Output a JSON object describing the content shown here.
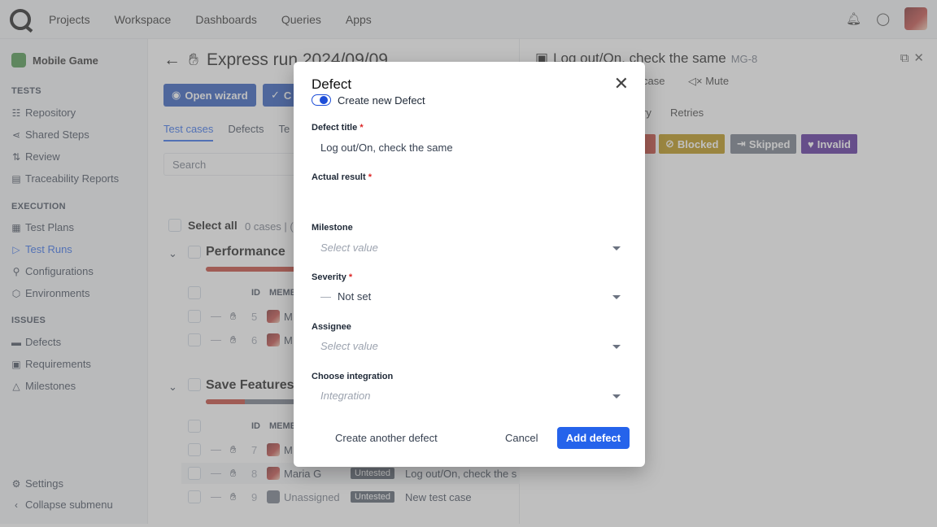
{
  "topnav": {
    "items": [
      "Projects",
      "Workspace",
      "Dashboards",
      "Queries",
      "Apps"
    ]
  },
  "sidebar": {
    "project": "Mobile Game",
    "sections": {
      "tests": "TESTS",
      "execution": "EXECUTION",
      "issues": "ISSUES"
    },
    "tests_items": [
      "Repository",
      "Shared Steps",
      "Review",
      "Traceability Reports"
    ],
    "execution_items": [
      "Test Plans",
      "Test Runs",
      "Configurations",
      "Environments"
    ],
    "issues_items": [
      "Defects",
      "Requirements",
      "Milestones"
    ],
    "settings": "Settings",
    "collapse": "Collapse submenu"
  },
  "middle": {
    "title": "Express run 2024/09/09",
    "open_wizard": "Open wizard",
    "second_btn": "C",
    "tabs": [
      "Test cases",
      "Defects",
      "Te"
    ],
    "search_placeholder": "Search",
    "select_all": "Select all",
    "cases_count": "0 cases | (",
    "suite1": "Performance",
    "suite2": "Save Features",
    "col_id": "ID",
    "col_member": "MEMB",
    "rows": [
      {
        "id": "5",
        "member": "M"
      },
      {
        "id": "6",
        "member": "M"
      },
      {
        "id": "7",
        "member": "M"
      },
      {
        "id": "8",
        "member": "Maria G",
        "status": "Untested",
        "title": "Log out/On, check the s"
      },
      {
        "id": "9",
        "member": "Unassigned",
        "status": "Untested",
        "title": "New test case"
      }
    ]
  },
  "right": {
    "title": "Log out/On, check the same",
    "key": "MG-8",
    "btn_case": "case",
    "btn_mute": "Mute",
    "tab_history": "ry",
    "tab_retries": "Retries",
    "statuses": [
      {
        "label": "Blocked",
        "color": "#b48a00"
      },
      {
        "label": "Skipped",
        "color": "#6b7280"
      },
      {
        "label": "Invalid",
        "color": "#4c1d95"
      }
    ]
  },
  "modal": {
    "title": "Defect",
    "toggle_label": "Create new Defect",
    "defect_title_label": "Defect title",
    "defect_title_value": "Log out/On, check the same",
    "actual_result_label": "Actual result",
    "milestone_label": "Milestone",
    "milestone_placeholder": "Select value",
    "severity_label": "Severity",
    "severity_value": "Not set",
    "assignee_label": "Assignee",
    "assignee_placeholder": "Select value",
    "integration_label": "Choose integration",
    "integration_placeholder": "Integration",
    "create_another": "Create another defect",
    "cancel": "Cancel",
    "add": "Add defect"
  }
}
